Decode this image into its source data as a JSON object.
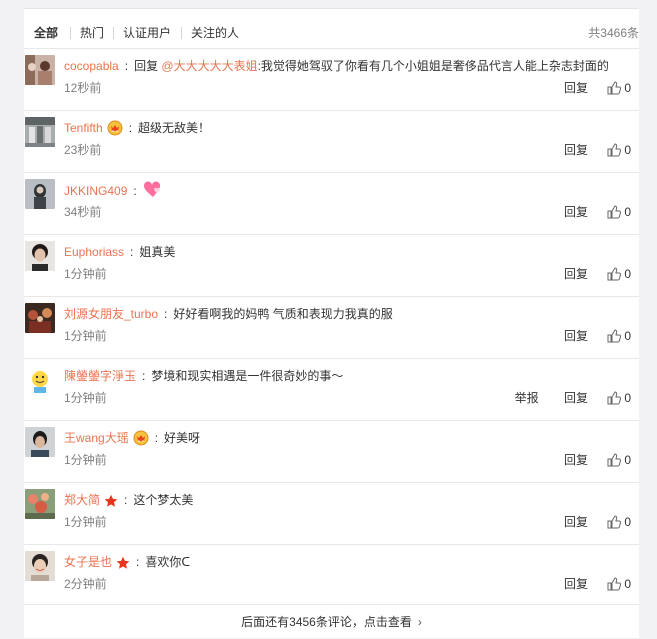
{
  "tabs": [
    {
      "label": "全部"
    },
    {
      "label": "热门"
    },
    {
      "label": "认证用户"
    },
    {
      "label": "关注的人"
    }
  ],
  "total_label": "共3466条",
  "reply_label": "回复",
  "report_label": "举报",
  "comments": [
    {
      "user": "cocopabla",
      "prefix": "回复 ",
      "mention": "@大大大大大表姐",
      "text": ":我觉得她驾驭了你看有几个小姐姐是奢侈品代言人能上杂志封面的",
      "time": "12秒前",
      "likes": "0"
    },
    {
      "user": "Tenfifth",
      "text": "超级无敌美！",
      "time": "23秒前",
      "likes": "0"
    },
    {
      "user": "JKKING409",
      "text": "",
      "time": "34秒前",
      "likes": "0"
    },
    {
      "user": "Euphoriass",
      "text": "姐真美",
      "time": "1分钟前",
      "likes": "0"
    },
    {
      "user": "刘源女朋友_turbo",
      "text": "好好看啊我的妈鸭 气质和表现力我真的服",
      "time": "1分钟前",
      "likes": "0"
    },
    {
      "user": "陳鎣鎣字淨玉",
      "text": "梦境和现实相遇是一件很奇妙的事～",
      "time": "1分钟前",
      "likes": "0"
    },
    {
      "user": "王wang大瑶",
      "text": "好美呀",
      "time": "1分钟前",
      "likes": "0"
    },
    {
      "user": "郑大简",
      "text": "这个梦太美",
      "time": "1分钟前",
      "likes": "0"
    },
    {
      "user": "女子是也",
      "text": "喜欢你ᑕ",
      "time": "2分钟前",
      "likes": "0"
    }
  ],
  "more_label": "后面还有3456条评论，点击查看",
  "colors": {
    "username": "#eb7350",
    "muted": "#808080",
    "border": "#e8e8e8",
    "background": "#f2f2f5"
  }
}
